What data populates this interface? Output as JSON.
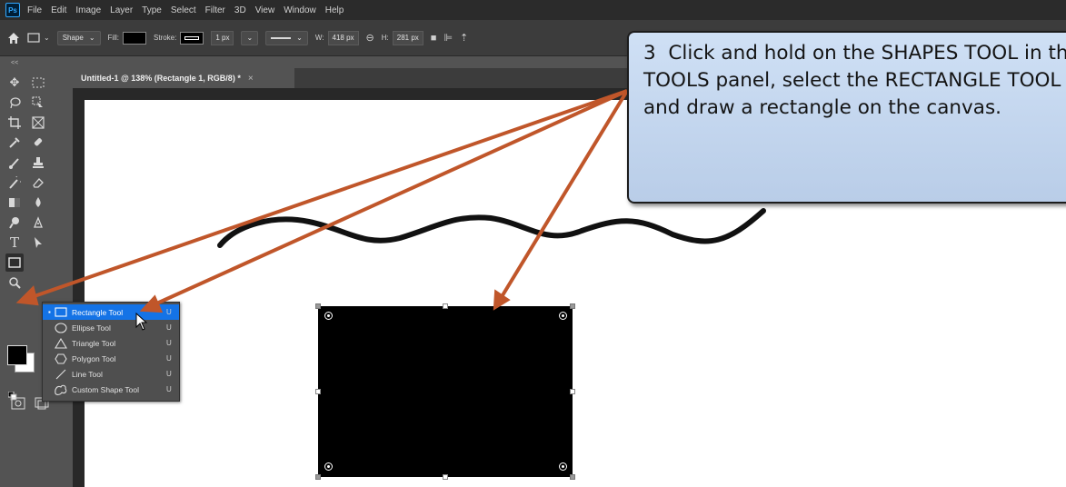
{
  "menu": {
    "logo": "Ps",
    "items": [
      "File",
      "Edit",
      "Image",
      "Layer",
      "Type",
      "Select",
      "Filter",
      "3D",
      "View",
      "Window",
      "Help"
    ]
  },
  "options": {
    "mode": "Shape",
    "fill_label": "Fill:",
    "stroke_label": "Stroke:",
    "stroke_width": "1 px",
    "w_label": "W:",
    "w_value": "418 px",
    "h_label": "H:",
    "h_value": "281 px",
    "link_icon": "link-icon"
  },
  "document": {
    "tab_title": "Untitled-1 @ 138% (Rectangle 1, RGB/8) *",
    "close": "×"
  },
  "tools": {
    "collapse": "<<"
  },
  "flyout": {
    "items": [
      {
        "label": "Rectangle Tool",
        "key": "U",
        "selected": true
      },
      {
        "label": "Ellipse Tool",
        "key": "U"
      },
      {
        "label": "Triangle Tool",
        "key": "U"
      },
      {
        "label": "Polygon Tool",
        "key": "U"
      },
      {
        "label": "Line Tool",
        "key": "U"
      },
      {
        "label": "Custom Shape Tool",
        "key": "U"
      }
    ]
  },
  "callout": {
    "step": "3",
    "text": "Click and hold on the SHAPES TOOL in the TOOLS panel, select the RECTANGLE TOOL and draw a rectangle  on the canvas."
  },
  "colors": {
    "arrow": "#c0562a",
    "selection_blue": "#1473e6",
    "callout_fill": "#c4d7ef"
  }
}
